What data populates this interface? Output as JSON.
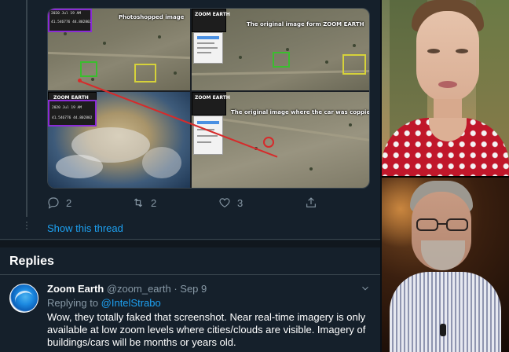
{
  "media": {
    "top_left_caption": "Photoshopped image",
    "top_right_caption": "The original image form ZOOM EARTH",
    "bottom_right_caption": "The original image where the car was coppied from",
    "ze_logo": "ZOOM EARTH",
    "ze_date": "2020  Jul  19  AM",
    "ze_coords": "41.546776 44.802802"
  },
  "actions": {
    "reply_count": "2",
    "retweet_count": "2",
    "like_count": "3"
  },
  "show_thread": "Show this thread",
  "replies_heading": "Replies",
  "reply": {
    "name": "Zoom Earth",
    "handle": "@zoom_earth",
    "dot": " · ",
    "date": "Sep 9",
    "replying_prefix": "Replying to ",
    "replying_user": "@IntelStrabo",
    "text": "Wow, they totally faked that screenshot. Near real-time imagery is only available at low zoom levels where cities/clouds are visible. Imagery of buildings/cars will be months or years old."
  },
  "colors": {
    "background": "#15202b",
    "accent": "#1da1f2",
    "secondary_text": "#8899a6"
  }
}
